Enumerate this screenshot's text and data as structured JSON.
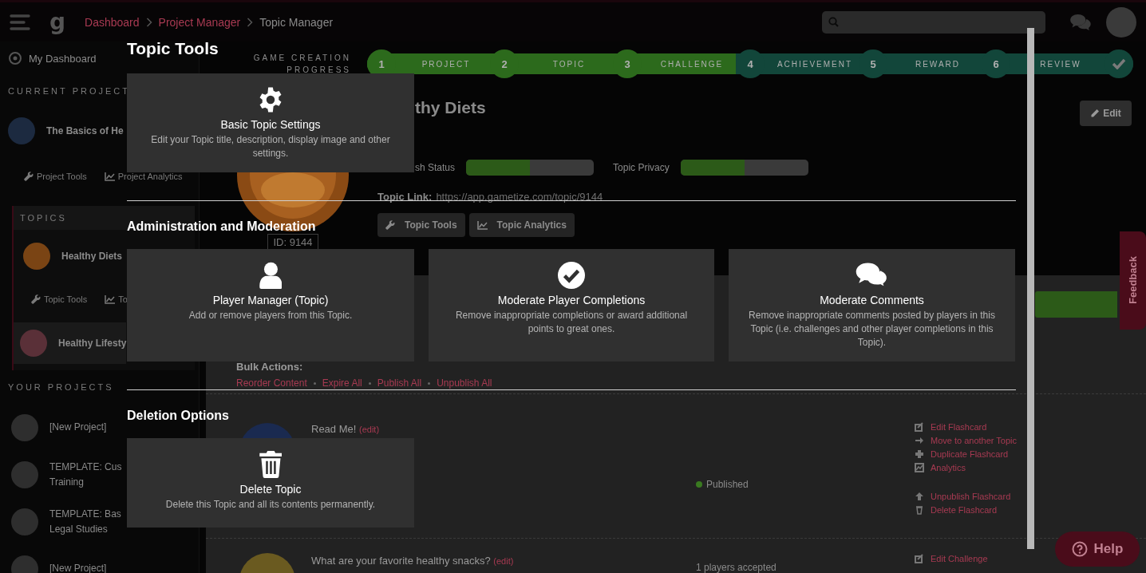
{
  "topbar": {
    "logo": "g",
    "breadcrumbs": [
      {
        "label": "Dashboard",
        "kind": "link"
      },
      {
        "label": "Project Manager",
        "kind": "link"
      },
      {
        "label": "Topic Manager",
        "kind": "current"
      }
    ]
  },
  "sidebar": {
    "dashboard_link": "My Dashboard",
    "current_project_heading": "CURRENT PROJECT",
    "current_project": "The Basics of He",
    "project_links": [
      "Project Tools",
      "Project Analytics"
    ],
    "topics_heading": "TOPICS",
    "topics": [
      {
        "title": "Healthy Diets",
        "selected": true,
        "links": [
          "Topic Tools",
          "To"
        ]
      },
      {
        "title": "Healthy Lifesty",
        "selected": false
      }
    ],
    "projects_heading": "YOUR PROJECTS",
    "projects": [
      {
        "title": "[New Project]"
      },
      {
        "title": "TEMPLATE: Cus",
        "subtitle": "Training"
      },
      {
        "title": "TEMPLATE: Bas",
        "subtitle": "Legal Studies"
      },
      {
        "title": "[New Project]"
      }
    ]
  },
  "progress": {
    "label": "GAME CREATION PROGRESS",
    "steps": [
      {
        "number": "1",
        "label": "PROJECT",
        "done": true
      },
      {
        "number": "2",
        "label": "TOPIC",
        "done": true
      },
      {
        "number": "3",
        "label": "CHALLENGE",
        "done": true
      },
      {
        "number": "4",
        "label": "ACHIEVEMENT",
        "done": false
      },
      {
        "number": "5",
        "label": "REWARD",
        "done": false
      },
      {
        "number": "6",
        "label": "REVIEW",
        "done": false
      }
    ]
  },
  "topic": {
    "title": "thy Diets",
    "id_badge": "ID: 9144",
    "edit_button": "Edit",
    "publish_label": "sh Status",
    "publish_on": true,
    "privacy_label": "Topic Privacy",
    "privacy_on": true,
    "link_label": "Topic Link:",
    "link_url": "https://app.gametize.com/topic/9144",
    "buttons": [
      "Topic Tools",
      "Topic Analytics"
    ]
  },
  "content": {
    "bulk_label": "Bulk Actions:",
    "bulk_links": [
      "Reorder Content",
      "Expire All",
      "Publish All",
      "Unpublish All"
    ],
    "items": [
      {
        "title": "Read Me!",
        "edit": "(edit)",
        "status": "Published",
        "actions": [
          "Edit Flashcard",
          "Move to another Topic",
          "Duplicate Flashcard",
          "Analytics",
          "Unpublish Flashcard",
          "Delete Flashcard"
        ]
      },
      {
        "title": "What are your favorite healthy snacks?",
        "edit": "(edit)",
        "status": "1 players accepted",
        "actions": [
          "Edit Challenge"
        ]
      }
    ]
  },
  "feedback": "Feedback",
  "help": "Help",
  "modal": {
    "title": "Topic Tools",
    "sections": [
      {
        "cards": [
          {
            "kind": "settings",
            "title": "Basic Topic Settings",
            "description": "Edit your Topic title, description, display image and other settings."
          }
        ]
      },
      {
        "heading": "Administration and Moderation",
        "cards": [
          {
            "kind": "player",
            "title": "Player Manager (Topic)",
            "description": "Add or remove players from this Topic."
          },
          {
            "kind": "check",
            "title": "Moderate Player Completions",
            "description": "Remove inappropriate completions or award additional points to great ones."
          },
          {
            "kind": "comments",
            "title": "Moderate Comments",
            "description": "Remove inappropriate comments posted by players in this Topic (i.e. challenges and other player completions in this Topic)."
          }
        ]
      },
      {
        "heading": "Deletion Options",
        "cards": [
          {
            "kind": "trash",
            "title": "Delete Topic",
            "description": "Delete this Topic and all its contents permanently."
          }
        ]
      }
    ]
  }
}
